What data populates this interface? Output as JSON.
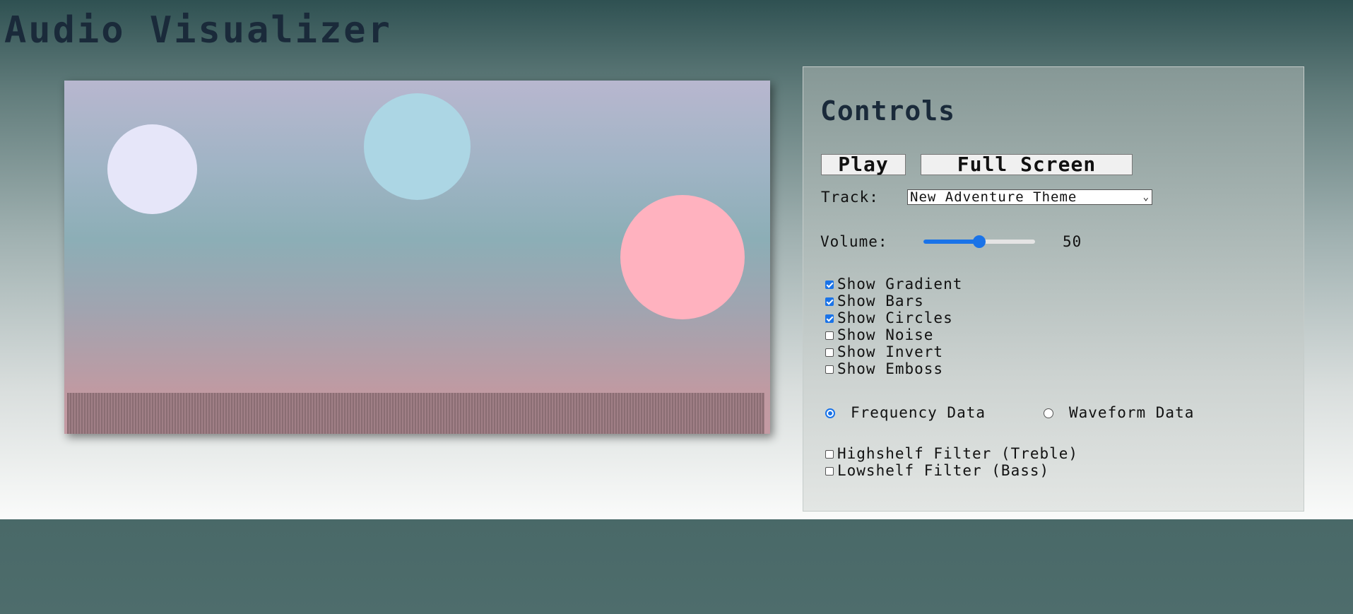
{
  "page": {
    "title": "Audio Visualizer"
  },
  "controls": {
    "heading": "Controls",
    "play_label": "Play",
    "fullscreen_label": "Full Screen",
    "track_label": "Track:",
    "track_selected": "New Adventure Theme",
    "volume_label": "Volume:",
    "volume_value": "50",
    "volume_level": 50,
    "options": [
      {
        "label": "Show Gradient",
        "checked": true
      },
      {
        "label": "Show Bars",
        "checked": true
      },
      {
        "label": "Show Circles",
        "checked": true
      },
      {
        "label": "Show Noise",
        "checked": false
      },
      {
        "label": "Show Invert",
        "checked": false
      },
      {
        "label": "Show Emboss",
        "checked": false
      }
    ],
    "data_modes": [
      {
        "label": "Frequency Data",
        "selected": true
      },
      {
        "label": "Waveform Data",
        "selected": false
      }
    ],
    "filters": [
      {
        "label": "Highshelf Filter (Treble)",
        "checked": false
      },
      {
        "label": "Lowshelf Filter (Bass)",
        "checked": false
      }
    ]
  },
  "colors": {
    "accent": "#1a73e8",
    "circle_1": "#e6e6f9",
    "circle_2": "#acd6e4",
    "circle_3": "#ffb2bf"
  }
}
